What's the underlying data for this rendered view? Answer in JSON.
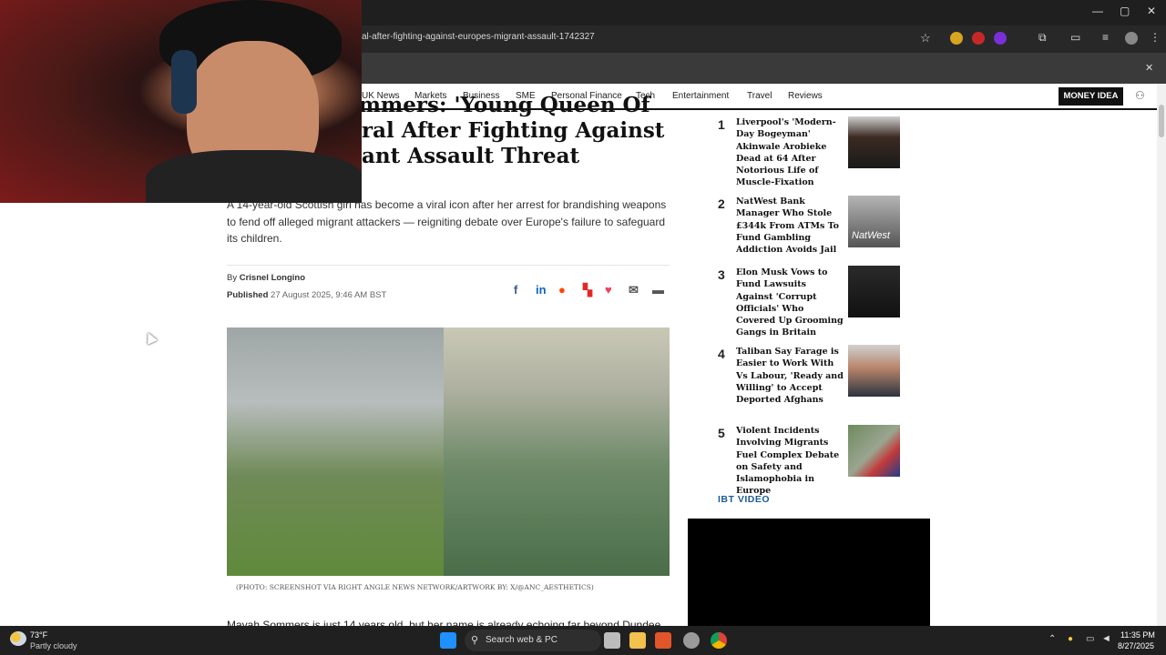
{
  "browser": {
    "url": "al-after-fighting-against-europes-migrant-assault-1742327",
    "controls": {
      "minimize": "—",
      "maximize": "▢",
      "close": "✕"
    },
    "bookmarkbar_close": "✕"
  },
  "nav": {
    "items": [
      "UK News",
      "Markets",
      "Business",
      "SME",
      "Personal Finance",
      "Tech",
      "Entertainment",
      "Travel",
      "Reviews"
    ],
    "money_idea": "MONEY IDEA"
  },
  "article": {
    "headline_lines": [
      "al Sommers: 'Young Queen Of",
      "ral After Fighting Against",
      "ant Assault Threat"
    ],
    "dek": "A 14-year-old Scottish girl has become a viral icon after her arrest for brandishing weapons to fend off alleged migrant attackers — reigniting debate over Europe's failure to safeguard its children.",
    "byline_prefix": "By",
    "author": "Crisnel Longino",
    "published_label": "Published",
    "published_date": "27 August 2025, 9:46 AM BST",
    "caption": "(PHOTO: SCREENSHOT VIA RIGHT ANGLE NEWS NETWORK/ARTWORK BY: X/@ANC_AESTHETICS)",
    "body_start": "Mayah Sommers is just 14 years old, but her name is already echoing far beyond Dundee."
  },
  "trending": [
    {
      "rank": "1",
      "title": "Liverpool's 'Modern-Day Bogeyman' Akinwale Arobieke Dead at 64 After Notorious Life of Muscle-Fixation"
    },
    {
      "rank": "2",
      "title": "NatWest Bank Manager Who Stole £344k From ATMs To Fund Gambling Addiction Avoids Jail"
    },
    {
      "rank": "3",
      "title": "Elon Musk Vows to Fund Lawsuits Against 'Corrupt Officials' Who Covered Up Grooming Gangs in Britain"
    },
    {
      "rank": "4",
      "title": "Taliban Say Farage is Easier to Work With Vs Labour, 'Ready and Willing' to Accept Deported Afghans"
    },
    {
      "rank": "5",
      "title": "Violent Incidents Involving Migrants Fuel Complex Debate on Safety and Islamophobia in Europe"
    }
  ],
  "thumb_labels": {
    "natwest": "NatWest"
  },
  "video_heading": "IBT VIDEO",
  "taskbar": {
    "weather_temp": "73°F",
    "weather_desc": "Partly cloudy",
    "search_label": "Search web & PC",
    "time": "11:35 PM",
    "date": "8/27/2025"
  },
  "colors": {
    "accent_blue": "#1a5b9b",
    "nav_bg": "#111111"
  }
}
